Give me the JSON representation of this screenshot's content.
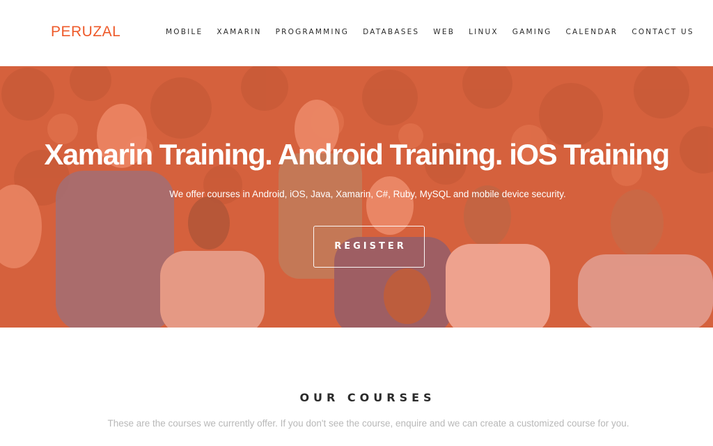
{
  "brand": {
    "name": "PERUZAL",
    "color": "#ee5a2a"
  },
  "nav": {
    "items": [
      {
        "label": "MOBILE"
      },
      {
        "label": "XAMARIN"
      },
      {
        "label": "PROGRAMMING"
      },
      {
        "label": "DATABASES"
      },
      {
        "label": "WEB"
      },
      {
        "label": "LINUX"
      },
      {
        "label": "GAMING"
      },
      {
        "label": "CALENDAR"
      },
      {
        "label": "CONTACT US"
      }
    ]
  },
  "hero": {
    "title": "Xamarin Training. Android Training. iOS Training",
    "subtitle": "We offer courses in Android, iOS, Java, Xamarin, C#, Ruby, MySQL and mobile device security.",
    "cta_label": "REGISTER",
    "overlay_color": "#f06e4b"
  },
  "courses": {
    "title": "OUR COURSES",
    "subtitle": "These are the courses we currently offer. If you don't see the course, enquire and we can create a customized course for you."
  }
}
